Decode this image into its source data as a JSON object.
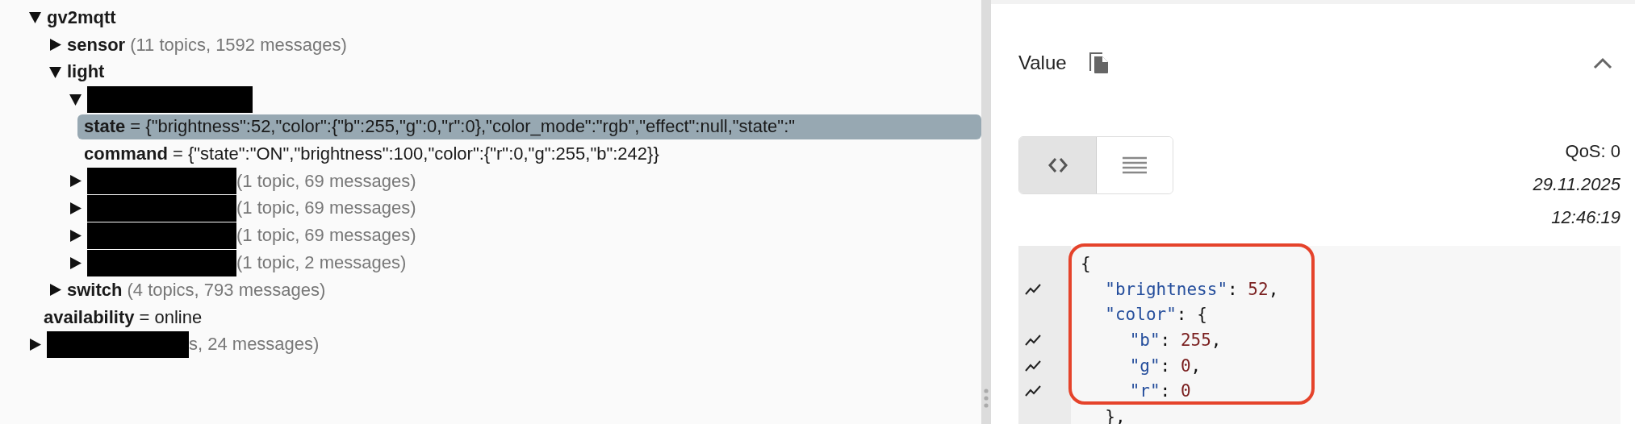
{
  "tree": [
    {
      "kind": "topic",
      "name": "gv2mqtt",
      "expanded": true,
      "selected": false,
      "children": [
        {
          "kind": "topic",
          "name": "sensor",
          "summary": "(11 topics, 1592 messages)",
          "expanded": false,
          "selected": false
        },
        {
          "kind": "topic",
          "name": "light",
          "expanded": true,
          "selected": false,
          "children": [
            {
              "kind": "redacted",
              "expanded": true,
              "selected": false,
              "children": [
                {
                  "kind": "value",
                  "name": "state",
                  "value": "= {\"brightness\":52,\"color\":{\"b\":255,\"g\":0,\"r\":0},\"color_mode\":\"rgb\",\"effect\":null,\"state\":\"",
                  "selected": true
                },
                {
                  "kind": "value",
                  "name": "command",
                  "value": "= {\"state\":\"ON\",\"brightness\":100,\"color\":{\"r\":0,\"g\":255,\"b\":242}}",
                  "selected": false
                }
              ]
            },
            {
              "kind": "redacted",
              "summary": "(1 topic, 69 messages)",
              "expanded": false,
              "selected": false
            },
            {
              "kind": "redacted",
              "summary": "(1 topic, 69 messages)",
              "expanded": false,
              "selected": false
            },
            {
              "kind": "redacted",
              "summary": "(1 topic, 69 messages)",
              "expanded": false,
              "selected": false
            },
            {
              "kind": "redacted",
              "summary": "(1 topic, 2 messages)",
              "expanded": false,
              "selected": false
            }
          ]
        },
        {
          "kind": "topic",
          "name": "switch",
          "summary": "(4 topics, 793 messages)",
          "expanded": false,
          "selected": false
        },
        {
          "kind": "value",
          "name": "availability",
          "value": "= online",
          "selected": false
        }
      ]
    },
    {
      "kind": "redacted",
      "summary": "s, 24 messages)",
      "expanded": false,
      "selected": false
    }
  ],
  "value_panel": {
    "title": "Value",
    "expanded": true,
    "view_modes": [
      {
        "kind": "code",
        "selected": true
      },
      {
        "kind": "raw",
        "selected": false
      }
    ],
    "qos": "QoS: 0",
    "date": "29.11.2025",
    "time": "12:46:19",
    "code_lines": [
      {
        "changed": false,
        "parts": [
          {
            "kind": "punct",
            "text": "{"
          }
        ]
      },
      {
        "changed": true,
        "parts": [
          {
            "kind": "key",
            "text": "\"brightness\""
          },
          {
            "kind": "punct",
            "text": ":"
          },
          {
            "kind": "number",
            "text": "52"
          },
          {
            "kind": "punct",
            "text": ","
          }
        ]
      },
      {
        "changed": false,
        "parts": [
          {
            "kind": "key",
            "text": "\"color\""
          },
          {
            "kind": "punct",
            "text": ":"
          },
          {
            "kind": "punct",
            "text": "{"
          }
        ]
      },
      {
        "changed": true,
        "parts": [
          {
            "kind": "key",
            "text": "\"b\""
          },
          {
            "kind": "punct",
            "text": ":"
          },
          {
            "kind": "number",
            "text": "255"
          },
          {
            "kind": "punct",
            "text": ","
          }
        ]
      },
      {
        "changed": true,
        "parts": [
          {
            "kind": "key",
            "text": "\"g\""
          },
          {
            "kind": "punct",
            "text": ":"
          },
          {
            "kind": "number",
            "text": "0"
          },
          {
            "kind": "punct",
            "text": ","
          }
        ]
      },
      {
        "changed": true,
        "parts": [
          {
            "kind": "key",
            "text": "\"r\""
          },
          {
            "kind": "punct",
            "text": ":"
          },
          {
            "kind": "number",
            "text": "0"
          }
        ]
      },
      {
        "changed": false,
        "parts": [
          {
            "kind": "punct",
            "text": "},"
          }
        ]
      }
    ],
    "annotation": {
      "kind": "rounded-rectangle"
    }
  }
}
